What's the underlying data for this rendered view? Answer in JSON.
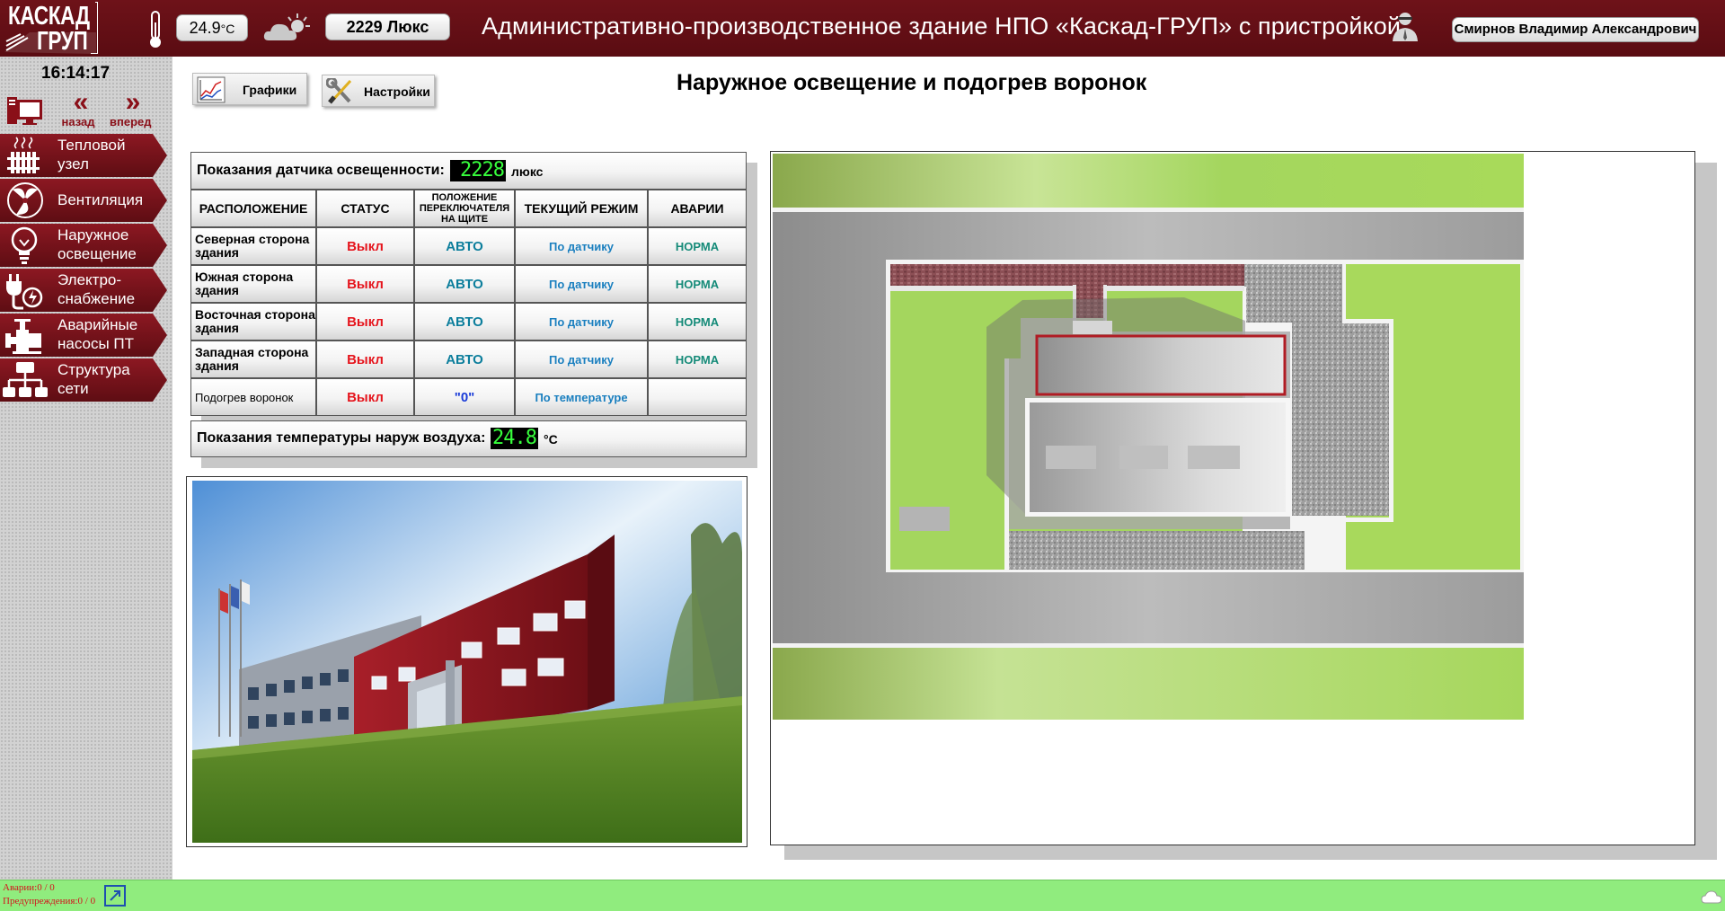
{
  "header": {
    "logo_line1": "КАСКАД",
    "logo_line2": "ГРУП",
    "outdoor_temp": "24.9",
    "outdoor_temp_unit": "°С",
    "illuminance": "2229 Люкс",
    "title": "Административно-производственное здание НПО «Каскад-ГРУП» с пристройкой",
    "user_name": "Смирнов Владимир Александрович",
    "thermometer_icon": "thermometer-icon",
    "weather_icon": "cloud-sun-icon",
    "user_icon": "user-icon"
  },
  "sidebar": {
    "clock": "16:14:17",
    "back_label": "назад",
    "forward_label": "вперед",
    "items": [
      {
        "label": "Тепловой узел",
        "icon": "radiator-icon"
      },
      {
        "label": "Вентиляция",
        "icon": "fan-icon"
      },
      {
        "label": "Наружное освещение",
        "icon": "lightbulb-icon"
      },
      {
        "label": "Электро-снабжение",
        "icon": "plug-icon"
      },
      {
        "label": "Аварийные насосы ПТ",
        "icon": "pump-icon"
      },
      {
        "label": "Структура сети",
        "icon": "network-icon"
      }
    ]
  },
  "toolbar": {
    "graphs_label": "Графики",
    "settings_label": "Настройки"
  },
  "page": {
    "title": "Наружное освещение и подогрев воронок"
  },
  "table": {
    "lux_label": "Показания датчика освещенности:",
    "lux_value": "2228",
    "lux_unit": "люкс",
    "headers": {
      "location": "РАСПОЛОЖЕНИЕ",
      "status": "СТАТУС",
      "switch": "ПОЛОЖЕНИЕ ПЕРЕКЛЮЧАТЕЛЯ НА ЩИТЕ",
      "mode": "ТЕКУЩИЙ РЕЖИМ",
      "alarms": "АВАРИИ"
    },
    "rows": [
      {
        "location": "Северная сторона здания",
        "status": "Выкл",
        "switch": "АВТО",
        "mode": "По датчику",
        "alarm": "НОРМА"
      },
      {
        "location": "Южная сторона здания",
        "status": "Выкл",
        "switch": "АВТО",
        "mode": "По датчику",
        "alarm": "НОРМА"
      },
      {
        "location": "Восточная сторона здания",
        "status": "Выкл",
        "switch": "АВТО",
        "mode": "По датчику",
        "alarm": "НОРМА"
      },
      {
        "location": "Западная сторона здания",
        "status": "Выкл",
        "switch": "АВТО",
        "mode": "По датчику",
        "alarm": "НОРМА"
      },
      {
        "location": "Подогрев воронок",
        "status": "Выкл",
        "switch": "\"0\"",
        "mode": "По температуре",
        "alarm": ""
      }
    ],
    "air_label": "Показания температуры наруж воздуха:",
    "air_value": "24.8",
    "air_unit": "°C"
  },
  "footer": {
    "alarms_label": "Аварии:",
    "alarms_value": "0 / 0",
    "warnings_label": "Предупреждения:",
    "warnings_value": "0 / 0"
  },
  "colors": {
    "header_bg": "#6e1219",
    "status_off": "#e5141c",
    "lcd_text": "#37ff3c",
    "footer_bg": "#90ec7e",
    "lawn": "#a4d65e"
  }
}
